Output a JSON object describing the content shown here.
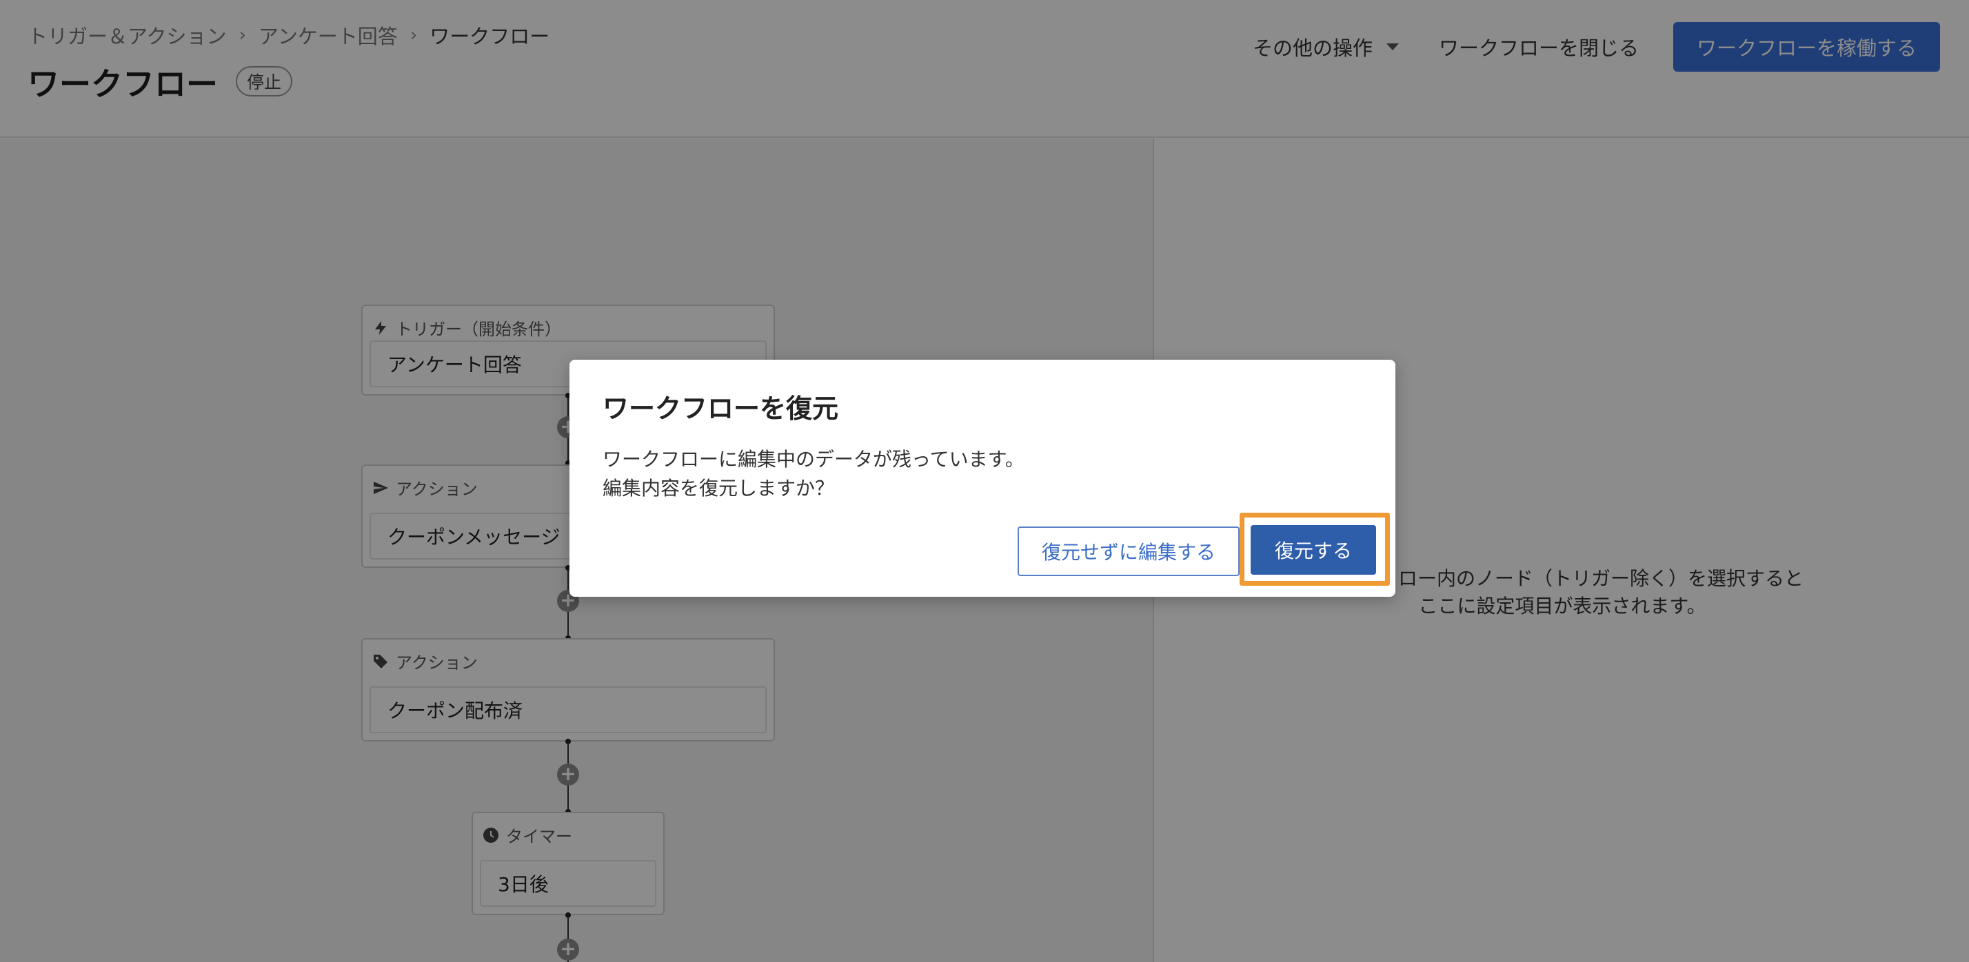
{
  "header": {
    "breadcrumb": [
      "トリガー＆アクション",
      "アンケート回答",
      "ワークフロー"
    ],
    "title": "ワークフロー",
    "status": "停止",
    "more_actions": "その他の操作",
    "close_workflow": "ワークフローを閉じる",
    "activate": "ワークフローを稼働する"
  },
  "nodes": [
    {
      "type_label": "トリガー（開始条件）",
      "icon": "bolt-icon",
      "value": "アンケート回答"
    },
    {
      "type_label": "アクション",
      "icon": "send-icon",
      "value": "クーポンメッセージ"
    },
    {
      "type_label": "アクション",
      "icon": "tag-icon",
      "value": "クーポン配布済"
    },
    {
      "type_label": "タイマー",
      "icon": "clock-icon",
      "value": "3日後"
    }
  ],
  "right_panel": {
    "hint_line1": "ワークフロー内のノード（トリガー除く）を選択すると",
    "hint_line2": "ここに設定項目が表示されます。"
  },
  "dialog": {
    "title": "ワークフローを復元",
    "body_line1": "ワークフローに編集中のデータが残っています。",
    "body_line2": "編集内容を復元しますか？",
    "secondary_button": "復元せずに編集する",
    "primary_button": "復元する"
  },
  "colors": {
    "accent": "#3a6fd8",
    "primary_button": "#2e5daa",
    "highlight": "#ef9a33"
  }
}
